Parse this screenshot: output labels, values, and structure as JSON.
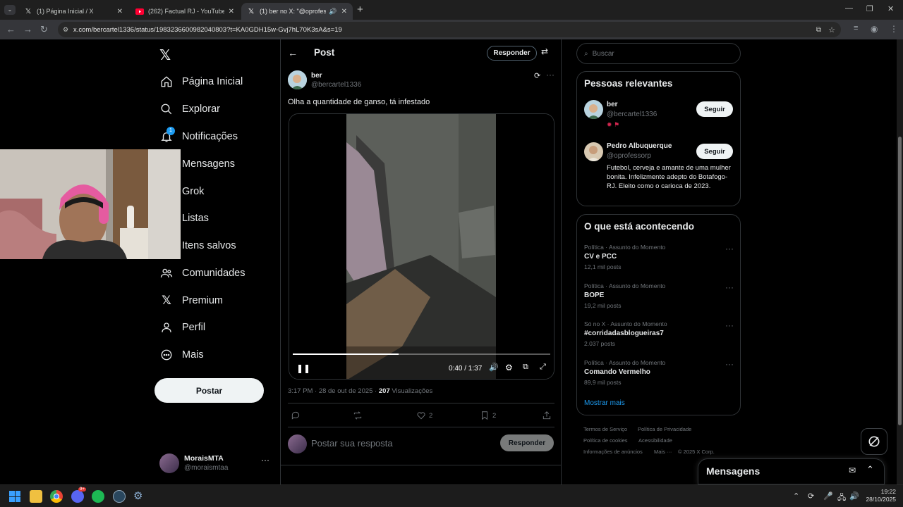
{
  "browser": {
    "tabs": [
      {
        "title": "(1) Página Inicial / X",
        "icon": "x-logo-icon",
        "active": false
      },
      {
        "title": "(262) Factual RJ - YouTube",
        "icon": "youtube-icon",
        "active": false
      },
      {
        "title": "(1) ber no X: \"@oprofessorp",
        "icon": "x-logo-icon",
        "active": true
      }
    ],
    "url": "x.com/bercartel1336/status/1983236600982040803?t=KA0GDH15w-Gvj7hL70K3sA&s=19"
  },
  "sidebar": {
    "items": [
      {
        "label": "Página Inicial",
        "icon": "home-icon"
      },
      {
        "label": "Explorar",
        "icon": "search-icon"
      },
      {
        "label": "Notificações",
        "icon": "bell-icon",
        "badge": "1"
      },
      {
        "label": "Mensagens",
        "icon": "mail-icon"
      },
      {
        "label": "Grok",
        "icon": "grok-icon"
      },
      {
        "label": "Listas",
        "icon": "list-icon"
      },
      {
        "label": "Itens salvos",
        "icon": "bookmark-icon"
      },
      {
        "label": "Comunidades",
        "icon": "people-icon"
      },
      {
        "label": "Premium",
        "icon": "x-logo-icon"
      },
      {
        "label": "Perfil",
        "icon": "person-icon"
      },
      {
        "label": "Mais",
        "icon": "more-circle-icon"
      }
    ],
    "post_button": "Postar",
    "account": {
      "name": "MoraisMTA",
      "handle": "@moraismtaa"
    }
  },
  "main": {
    "header_title": "Post",
    "reply_button": "Responder",
    "post": {
      "author_name": "ber",
      "author_handle": "@bercartel1336",
      "text": "Olha a quantidade de ganso, tá infestado",
      "video": {
        "time": "0:40 / 1:37",
        "progress": 0.41
      },
      "timestamp": "3:17 PM · 28 de out de 2025 · ",
      "views_count": "207",
      "views_label": " Visualizações",
      "likes": "2",
      "bookmarks": "2"
    },
    "reply_placeholder": "Postar sua resposta",
    "reply_submit": "Responder"
  },
  "right": {
    "search_placeholder": "Buscar",
    "relevant": {
      "title": "Pessoas relevantes",
      "people": [
        {
          "name": "ber",
          "handle": "@bercartel1336",
          "button": "Seguir",
          "bio": ""
        },
        {
          "name": "Pedro Albuquerque",
          "handle": "@oprofessorp",
          "button": "Seguir",
          "bio": "Futebol, cerveja e amante de uma mulher bonita. Infelizmente adepto do Botafogo- RJ. Eleito como o carioca de 2023."
        }
      ]
    },
    "trends": {
      "title": "O que está acontecendo",
      "items": [
        {
          "category": "Política · Assunto do Momento",
          "name": "CV e PCC",
          "count": "12,1 mil posts"
        },
        {
          "category": "Política · Assunto do Momento",
          "name": "BOPE",
          "count": "19,2 mil posts"
        },
        {
          "category": "Só no X · Assunto do Momento",
          "name": "#corridadasblogueiras7",
          "count": "2.037 posts"
        },
        {
          "category": "Política · Assunto do Momento",
          "name": "Comando Vermelho",
          "count": "89,9 mil posts"
        }
      ],
      "show_more": "Mostrar mais"
    },
    "footer": [
      "Termos de Serviço",
      "Política de Privacidade",
      "Política de cookies",
      "Acessibilidade",
      "Informações de anúncios",
      "Mais ···",
      "© 2025 X Corp."
    ],
    "messages_drawer": "Mensagens"
  },
  "taskbar": {
    "time": "19:22",
    "date": "28/10/2025",
    "discord_badge": "9+"
  },
  "colors": {
    "accent": "#1d9bf0",
    "background": "#000000",
    "border": "#2f3336",
    "muted": "#71767b"
  }
}
